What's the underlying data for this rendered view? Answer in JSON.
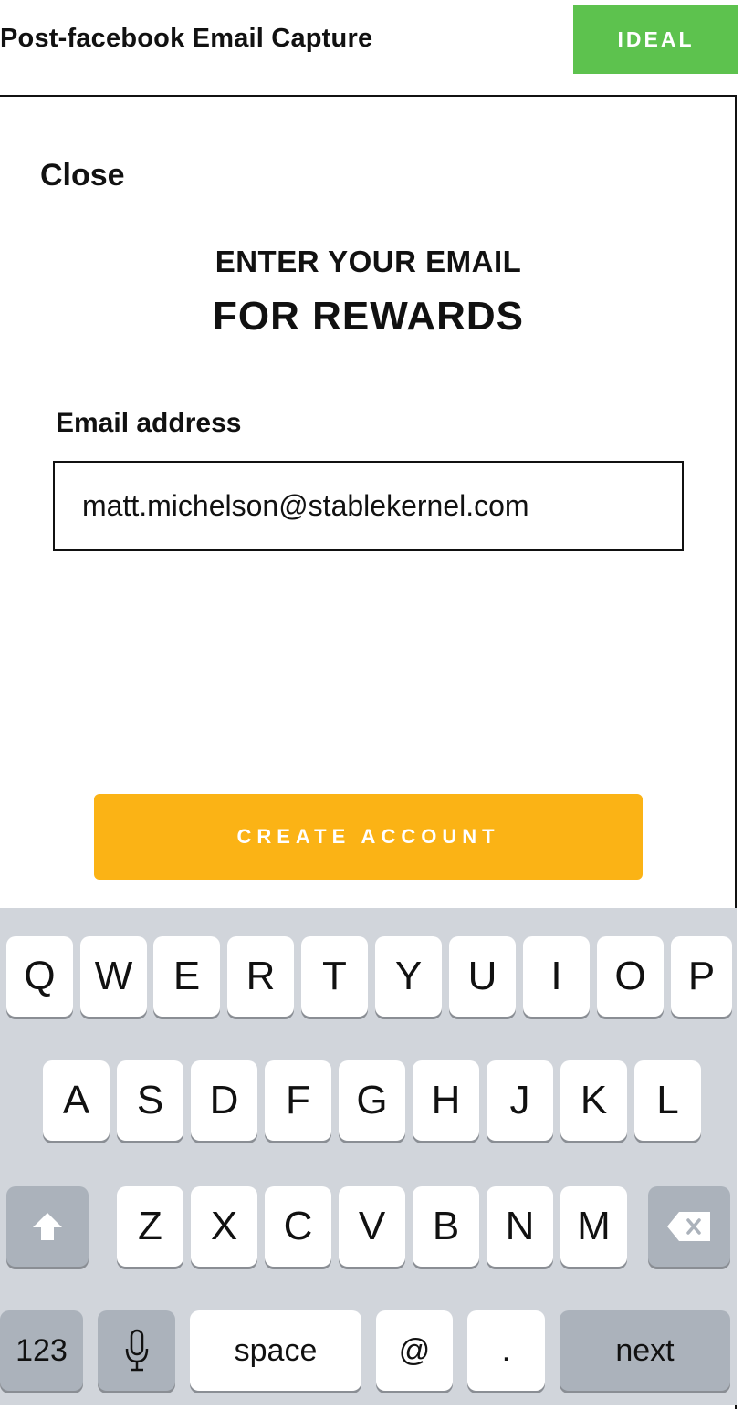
{
  "caption": "Post-facebook Email Capture",
  "badge": "IDEAL",
  "screen": {
    "close_label": "Close",
    "heading_line1": "ENTER YOUR EMAIL",
    "heading_line2": "FOR REWARDS",
    "email_label": "Email address",
    "email_value": "matt.michelson@stablekernel.com",
    "cta_label": "CREATE ACCOUNT",
    "cta_color": "#fbb315"
  },
  "keyboard": {
    "row1": [
      "Q",
      "W",
      "E",
      "R",
      "T",
      "Y",
      "U",
      "I",
      "O",
      "P"
    ],
    "row2": [
      "A",
      "S",
      "D",
      "F",
      "G",
      "H",
      "J",
      "K",
      "L"
    ],
    "row3": [
      "Z",
      "X",
      "C",
      "V",
      "B",
      "N",
      "M"
    ],
    "shift_icon": "shift-arrow-icon",
    "delete_icon": "backspace-icon",
    "numbers_label": "123",
    "mic_icon": "microphone-icon",
    "space_label": "space",
    "at_label": "@",
    "dot_label": ".",
    "next_label": "next"
  }
}
